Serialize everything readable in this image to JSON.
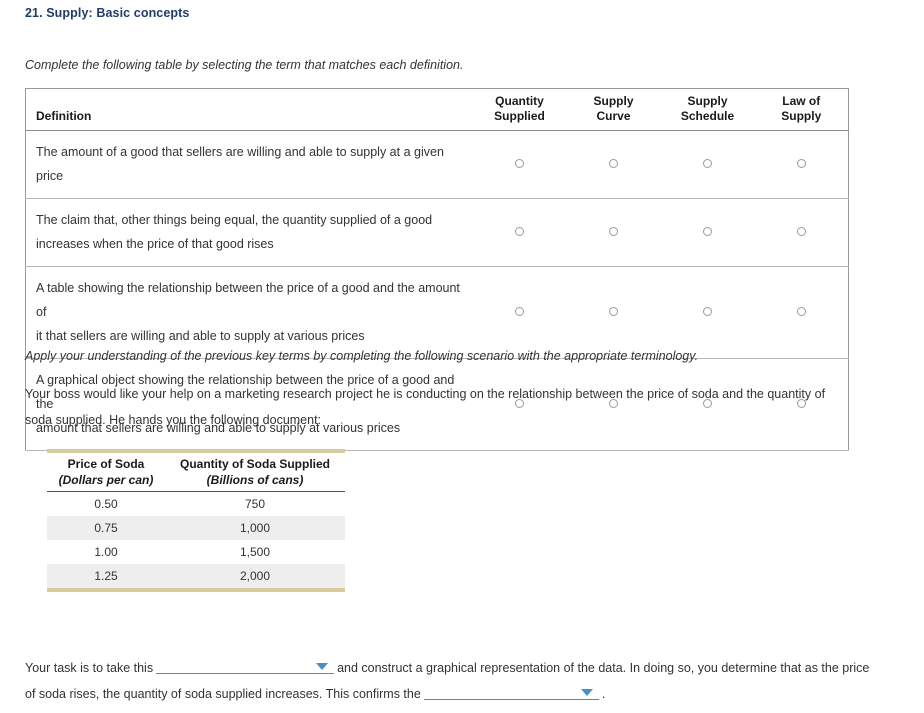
{
  "page": {
    "title": "21. Supply: Basic concepts",
    "instruction": "Complete the following table by selecting the term that matches each definition.",
    "apply_line": "Apply your understanding of the previous key terms by completing the following scenario with the appropriate terminology.",
    "scenario": "Your boss would like your help on a marketing research project he is conducting on the relationship between the price of soda and the quantity of soda supplied. He hands you the following document:"
  },
  "colors": {
    "title": "#1f3d66",
    "dropdown_accent": "#4a8fc4",
    "doc_rule": "#d5cb9b",
    "row_shade": "#eeeeee",
    "table_border": "#9a9a9a"
  },
  "match_table": {
    "definition_header": "Definition",
    "term_headers": [
      {
        "line1": "Quantity",
        "line2": "Supplied"
      },
      {
        "line1": "Supply",
        "line2": "Curve"
      },
      {
        "line1": "Supply",
        "line2": "Schedule"
      },
      {
        "line1": "Law of",
        "line2": "Supply"
      }
    ],
    "rows": [
      {
        "definition_lines": [
          "The amount of a good that sellers are willing and able to supply at a given price"
        ],
        "selected": null
      },
      {
        "definition_lines": [
          "The claim that, other things being equal, the quantity supplied of a good",
          "increases when the price of that good rises"
        ],
        "selected": null
      },
      {
        "definition_lines": [
          "A table showing the relationship between the price of a good and the amount of",
          "it that sellers are willing and able to supply at various prices"
        ],
        "selected": null
      },
      {
        "definition_lines": [
          "A graphical object showing the relationship between the price of a good and the",
          "amount that sellers are willing and able to supply at various prices"
        ],
        "selected": null
      }
    ]
  },
  "doc_table": {
    "headers": [
      {
        "main": "Price of Soda",
        "sub": "(Dollars per can)"
      },
      {
        "main": "Quantity of Soda Supplied",
        "sub": "(Billions of cans)"
      }
    ],
    "rows": [
      {
        "price": "0.50",
        "quantity": "750"
      },
      {
        "price": "0.75",
        "quantity": "1,000"
      },
      {
        "price": "1.00",
        "quantity": "1,500"
      },
      {
        "price": "1.25",
        "quantity": "2,000"
      }
    ]
  },
  "task": {
    "part1": "Your task is to take this",
    "dropdown1_value": "",
    "part2": "and construct a graphical representation of the data. In doing so, you determine that as the price of soda rises, the quantity of soda supplied increases. This confirms the",
    "dropdown2_value": "",
    "part3": "."
  }
}
